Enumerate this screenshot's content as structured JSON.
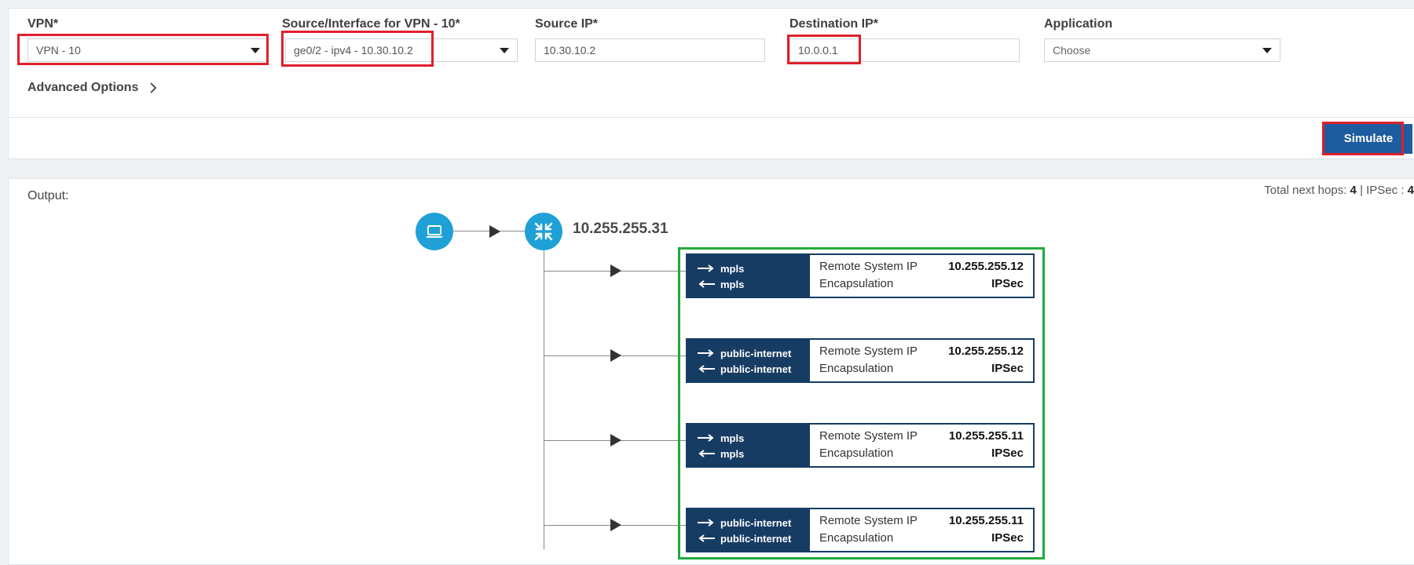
{
  "form": {
    "vpn": {
      "label": "VPN*",
      "value": "VPN - 10"
    },
    "source_interface": {
      "label": "Source/Interface for VPN - 10*",
      "value": "ge0/2 - ipv4 - 10.30.10.2"
    },
    "source_ip": {
      "label": "Source IP*",
      "value": "10.30.10.2"
    },
    "destination_ip": {
      "label": "Destination IP*",
      "value": "10.0.0.1"
    },
    "application": {
      "label": "Application",
      "placeholder": "Choose"
    },
    "advanced_options": "Advanced Options",
    "simulate_button": "Simulate"
  },
  "output": {
    "label": "Output:",
    "summary": {
      "hops_label": "Total next hops:",
      "hops_value": "4",
      "ipsec_label": "| IPSec :",
      "ipsec_value": "4"
    },
    "router_ip": "10.255.255.31",
    "hops": [
      {
        "out_transport": "mpls",
        "in_transport": "mpls",
        "remote_label": "Remote System IP",
        "remote_ip": "10.255.255.12",
        "encap_label": "Encapsulation",
        "encap": "IPSec"
      },
      {
        "out_transport": "public-internet",
        "in_transport": "public-internet",
        "remote_label": "Remote System IP",
        "remote_ip": "10.255.255.12",
        "encap_label": "Encapsulation",
        "encap": "IPSec"
      },
      {
        "out_transport": "mpls",
        "in_transport": "mpls",
        "remote_label": "Remote System IP",
        "remote_ip": "10.255.255.11",
        "encap_label": "Encapsulation",
        "encap": "IPSec"
      },
      {
        "out_transport": "public-internet",
        "in_transport": "public-internet",
        "remote_label": "Remote System IP",
        "remote_ip": "10.255.255.11",
        "encap_label": "Encapsulation",
        "encap": "IPSec"
      }
    ]
  },
  "icons": {
    "source": "laptop-icon",
    "router": "router-icon",
    "chevron": "chevron-right-icon",
    "arrow_out": "arrow-right-icon",
    "arrow_in": "arrow-left-icon"
  },
  "colors": {
    "highlight_red": "#e0202b",
    "highlight_green": "#22aa3c",
    "accent_blue": "#1d5c9e",
    "node_blue": "#1fa1d8",
    "hop_navy": "#173c64"
  }
}
